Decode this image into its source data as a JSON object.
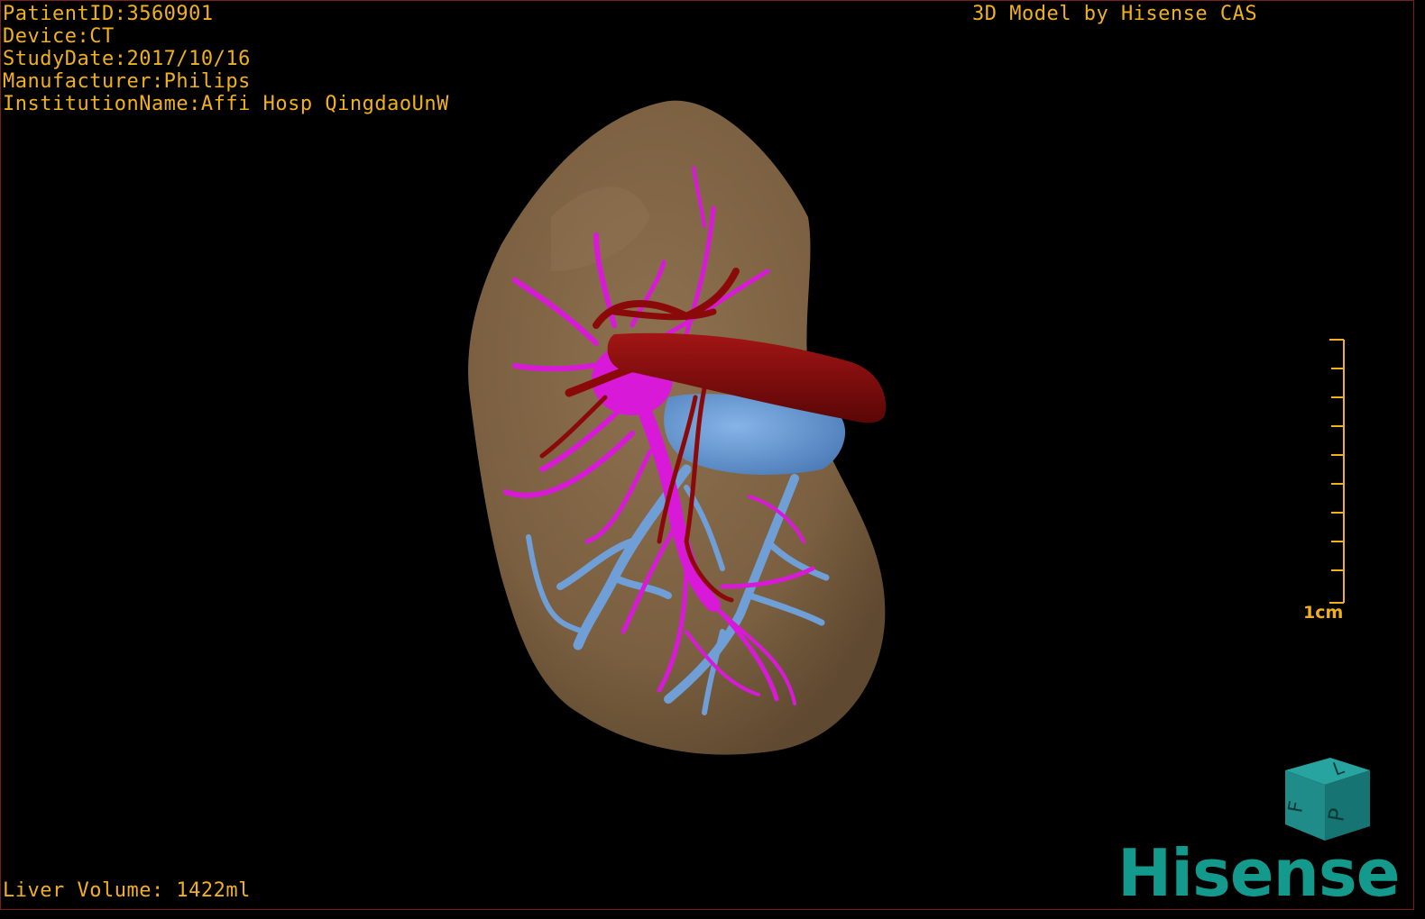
{
  "overlay": {
    "patient_id": "PatientID:3560901",
    "device": "Device:CT",
    "study_date": "StudyDate:2017/10/16",
    "manufacturer": "Manufacturer:Philips",
    "institution": "InstitutionName:Affi Hosp QingdaoUnW",
    "model_title": "3D Model by Hisense CAS",
    "liver_volume": "Liver Volume: 1422ml"
  },
  "scale_bar": {
    "label": "1cm"
  },
  "orientation_cube": {
    "face_top": "L",
    "face_side": "F",
    "face_front": "P",
    "color": "#1a8a88"
  },
  "brand": {
    "logo_text": "Hisense",
    "color": "#149a8c"
  },
  "colors": {
    "overlay_text": "#f0b020",
    "liver": "#7f6443",
    "portal_vein": "#d81ad8",
    "hepatic_artery": "#8a0a0a",
    "hepatic_vein": "#6f9fd6"
  },
  "icons": [
    "orientation-cube-icon",
    "scale-bar-icon"
  ]
}
